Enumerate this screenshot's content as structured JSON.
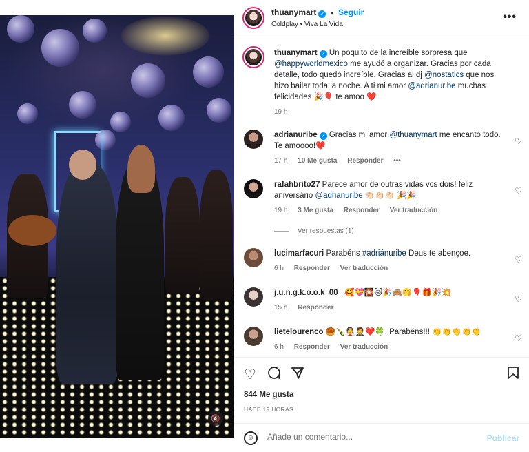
{
  "post": {
    "author": "thuanymart",
    "follow_label": "Seguir",
    "separator": "•",
    "audio": "Coldplay • Viva La Vida",
    "more": "•••"
  },
  "caption": {
    "username": "thuanymart",
    "text_1": "Un poquito de la increíble sorpresa que",
    "mention_1": "@happyworldmexico",
    "text_2": "me ayudó a organizar. Gracias por cada detalle, todo quedó increíble. Gracias al dj",
    "mention_2": "@nostatics",
    "text_3": "que nos hizo bailar toda la noche. A ti mi amor",
    "mention_3": "@adrianuribe",
    "text_4": "muchas felicidades 🎉🎈 te amoo ❤️",
    "time": "19 h"
  },
  "comments": [
    {
      "username": "adrianuribe",
      "pre": "Gracias mi amor",
      "mention": "@thuanymart",
      "post": "me encanto todo. Te amoooo!❤️",
      "time": "17 h",
      "likes": "10 Me gusta",
      "reply": "Responder",
      "more": "•••"
    },
    {
      "username": "rafahbrito27",
      "pre": "Parece amor de outras vidas vcs dois! feliz aniversário",
      "mention": "@adrianuribe",
      "post": "👏🏻👏🏻👏🏻 🎉🎉",
      "time": "19 h",
      "likes": "3 Me gusta",
      "reply": "Responder",
      "translate": "Ver traducción",
      "view_replies": "Ver respuestas (1)"
    },
    {
      "username": "lucimarfacuri",
      "pre": "Parabéns",
      "mention": "#adriánuribe",
      "post": "Deus te abençoe.",
      "time": "6 h",
      "reply": "Responder",
      "translate": "Ver traducción"
    },
    {
      "username": "j.u.n.g.k.o.o.k_00_",
      "pre": "🥰💝🎇😻🎉🙈🤭🎈🎁🎉💥",
      "time": "15 h",
      "reply": "Responder"
    },
    {
      "username": "lietelourenco",
      "pre": "🥮🍾👰🤵❤️🍀. Parabéns!!! 👏👏👏👏👏",
      "time": "6 h",
      "reply": "Responder",
      "translate": "Ver traducción"
    }
  ],
  "actions": {
    "likes": "844 Me gusta",
    "time": "HACE 19 HORAS"
  },
  "add_comment": {
    "placeholder": "Añade un comentario...",
    "publish": "Publicar"
  },
  "colors": {
    "accent": "#0095f6",
    "link": "#00376b",
    "muted": "#737373",
    "heart_red": "#ed4956"
  }
}
